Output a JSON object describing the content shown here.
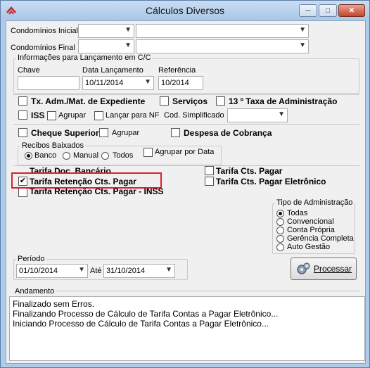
{
  "window": {
    "title": "Cálculos Diversos"
  },
  "condominios": {
    "inicial_label": "Condomínios Inicial",
    "final_label": "Condomínios Final",
    "inicial_code": "",
    "inicial_name": "",
    "final_code": "",
    "final_name": ""
  },
  "info_cc": {
    "group_title": "Informações para Lançamento em C/C",
    "chave_label": "Chave",
    "chave_value": "",
    "data_label": "Data Lançamento",
    "data_value": "10/11/2014",
    "referencia_label": "Referência",
    "referencia_value": "10/2014"
  },
  "options": {
    "tx_adm": {
      "label": "Tx. Adm./Mat. de Expediente",
      "checked": false
    },
    "servicos": {
      "label": "Serviços",
      "checked": false
    },
    "taxa13": {
      "label": "13 º Taxa de Administração",
      "checked": false
    },
    "iss": {
      "label": "ISS",
      "checked": false
    },
    "agrupar1": {
      "label": "Agrupar",
      "checked": false
    },
    "lancar_nf": {
      "label": "Lançar para NF",
      "checked": false
    },
    "cod_simplificado_label": "Cod. Simplificado",
    "cod_simplificado_value": "",
    "cheque_superior": {
      "label": "Cheque Superior",
      "checked": false
    },
    "agrupar2": {
      "label": "Agrupar",
      "checked": false
    },
    "despesa_cobranca": {
      "label": "Despesa de Cobrança",
      "checked": false
    }
  },
  "recibos": {
    "group_title": "Recibos Baixados",
    "banco": "Banco",
    "manual": "Manual",
    "todos": "Todos",
    "selected": "Banco",
    "agrupar_por_data": "Agrupar por Data"
  },
  "tarifas": {
    "doc_bancario": "Tarifa Doc. Bancário",
    "retencao_pagar": "Tarifa Retenção Cts. Pagar",
    "retencao_inss": "Tarifa Retenção Cts. Pagar - INSS",
    "cts_pagar": "Tarifa Cts. Pagar",
    "cts_pagar_eletronico": "Tarifa Cts. Pagar Eletrônico",
    "retencao_pagar_checked": true
  },
  "tipo_adm": {
    "group_title": "Tipo de Administração",
    "options": [
      "Todas",
      "Convencional",
      "Conta Própria",
      "Gerência Completa",
      "Auto Gestão"
    ],
    "selected": "Todas"
  },
  "periodo": {
    "group_title": "Período",
    "de_value": "01/10/2014",
    "ate_label": "Até",
    "ate_value": "31/10/2014"
  },
  "processar_label": "Processar",
  "andamento": {
    "group_title": "Andamento",
    "lines": [
      "Finalizado sem Erros.",
      "Finalizando Processo de Cálculo de Tarifa Contas a Pagar Eletrônico...",
      "Iniciando Processo de Cálculo de Tarifa Contas a Pagar Eletrônico..."
    ]
  },
  "colors": {
    "highlight": "#d6222b",
    "titlebar": "#b8d2ec"
  }
}
